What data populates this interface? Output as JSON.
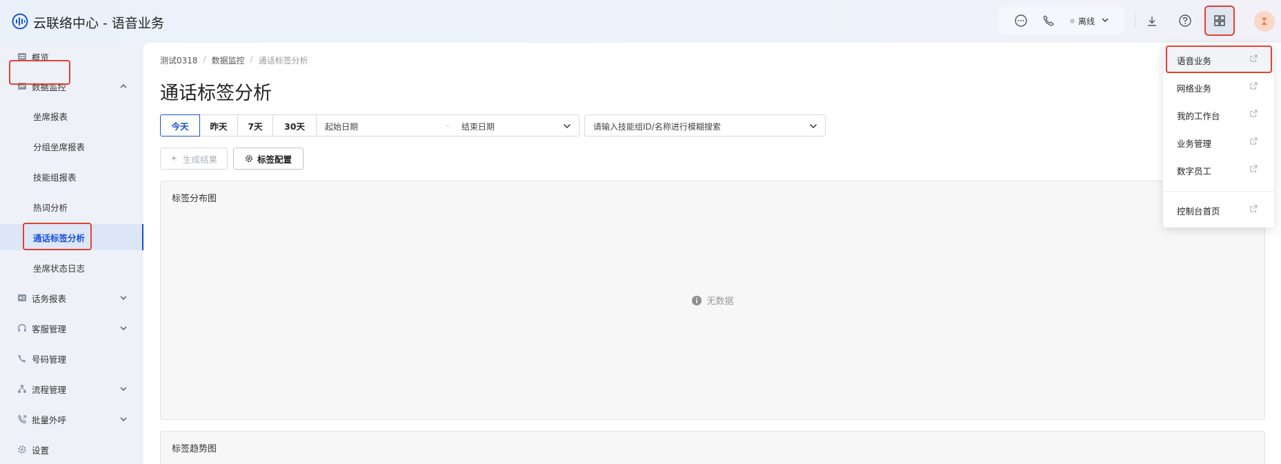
{
  "app": {
    "title": "云联络中心 - 语音业务"
  },
  "header": {
    "status_label": "离线",
    "icons": [
      "chat-icon",
      "phone-icon",
      "download-icon",
      "help-icon",
      "apps-grid-icon",
      "avatar"
    ]
  },
  "sidebar": {
    "items": [
      {
        "label": "概览",
        "icon": "overview-icon"
      },
      {
        "label": "数据监控",
        "icon": "monitor-icon",
        "expanded": true
      },
      {
        "label": "坐席报表"
      },
      {
        "label": "分组坐席报表"
      },
      {
        "label": "技能组报表"
      },
      {
        "label": "热词分析"
      },
      {
        "label": "通话标签分析",
        "active": true
      },
      {
        "label": "坐席状态日志"
      },
      {
        "label": "话务报表",
        "icon": "report-icon"
      },
      {
        "label": "客服管理",
        "icon": "headset-icon"
      },
      {
        "label": "号码管理",
        "icon": "phone-icon"
      },
      {
        "label": "流程管理",
        "icon": "flow-icon"
      },
      {
        "label": "批量外呼",
        "icon": "outbound-icon"
      },
      {
        "label": "设置",
        "icon": "gear-icon"
      }
    ]
  },
  "breadcrumb": [
    "测试0318",
    "数据监控",
    "通话标签分析"
  ],
  "page": {
    "title": "通话标签分析"
  },
  "filters": {
    "ranges": [
      "今天",
      "昨天",
      "7天",
      "30天"
    ],
    "selected_range": "今天",
    "start_placeholder": "起始日期",
    "separator": "-",
    "end_placeholder": "结束日期",
    "search_placeholder": "请输入技能组ID/名称进行模糊搜索"
  },
  "actions": {
    "generate_label": "生成结果",
    "config_label": "标签配置"
  },
  "cards": [
    {
      "title": "标签分布图",
      "empty_text": "无数据"
    },
    {
      "title": "标签趋势图"
    }
  ],
  "dropdown": {
    "items": [
      "语音业务",
      "网络业务",
      "我的工作台",
      "业务管理",
      "数字员工",
      "控制台首页"
    ],
    "active": "语音业务"
  },
  "colors": {
    "primary": "#1750d8",
    "highlight_border": "#e2412d",
    "sidebar_bg": "#eef2f8"
  }
}
